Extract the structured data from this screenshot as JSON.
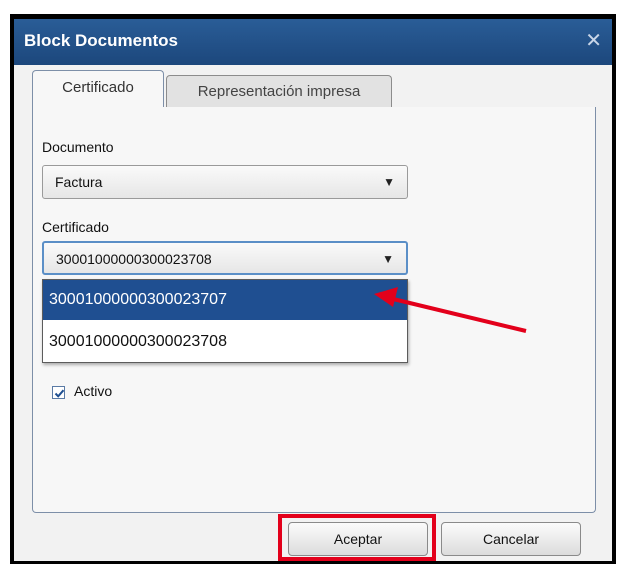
{
  "dialog": {
    "title": "Block Documentos",
    "close_glyph": "✕"
  },
  "tabs": [
    {
      "label": "Certificado",
      "active": true
    },
    {
      "label": "Representación impresa",
      "active": false
    }
  ],
  "form": {
    "documento": {
      "label": "Documento",
      "value": "Factura"
    },
    "certificado": {
      "label": "Certificado",
      "value": "30001000000300023708",
      "options": [
        "30001000000300023707",
        "30001000000300023708"
      ],
      "highlighted_index": 0
    },
    "activo": {
      "label": "Activo",
      "checked": true
    }
  },
  "buttons": {
    "accept": "Aceptar",
    "cancel": "Cancelar"
  },
  "annotations": {
    "arrow_color": "#e3001b",
    "box_color": "#e3001b"
  },
  "icons": {
    "dropdown": "▼"
  }
}
